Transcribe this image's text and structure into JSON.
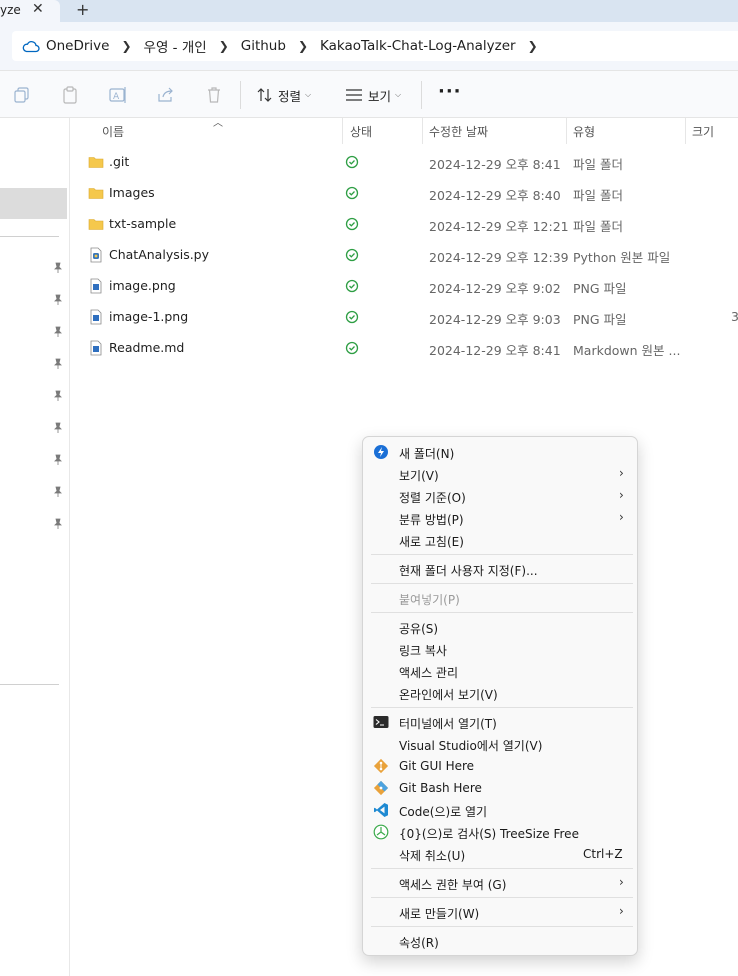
{
  "tab": {
    "title": "yze",
    "close": "✕",
    "new": "+"
  },
  "breadcrumb": [
    "OneDrive",
    "우영 - 개인",
    "Github",
    "KakaoTalk-Chat-Log-Analyzer"
  ],
  "toolbar": {
    "sort_label": "정렬",
    "view_label": "보기",
    "more": "···"
  },
  "columns": {
    "name": "이름",
    "status": "상태",
    "modified": "수정한 날짜",
    "type": "유형",
    "size": "크기"
  },
  "files": [
    {
      "name": ".git",
      "icon": "folder-icon",
      "date": "2024-12-29 오후 8:41",
      "type": "파일 폴더",
      "size": ""
    },
    {
      "name": "Images",
      "icon": "folder-icon",
      "date": "2024-12-29 오후 8:40",
      "type": "파일 폴더",
      "size": ""
    },
    {
      "name": "txt-sample",
      "icon": "folder-icon",
      "date": "2024-12-29 오후 12:21",
      "type": "파일 폴더",
      "size": ""
    },
    {
      "name": "ChatAnalysis.py",
      "icon": "python-file-icon",
      "date": "2024-12-29 오후 12:39",
      "type": "Python 원본 파일",
      "size": ""
    },
    {
      "name": "image.png",
      "icon": "image-file-icon",
      "date": "2024-12-29 오후 9:02",
      "type": "PNG 파일",
      "size": ""
    },
    {
      "name": "image-1.png",
      "icon": "image-file-icon",
      "date": "2024-12-29 오후 9:03",
      "type": "PNG 파일",
      "size": "3"
    },
    {
      "name": "Readme.md",
      "icon": "markdown-file-icon",
      "date": "2024-12-29 오후 8:41",
      "type": "Markdown 원본 ...",
      "size": ""
    }
  ],
  "menu": {
    "new_folder": "새 폴더(N)",
    "view": "보기(V)",
    "sort_by": "정렬 기준(O)",
    "group_by": "분류 방법(P)",
    "refresh": "새로 고침(E)",
    "customize": "현재 폴더 사용자 지정(F)...",
    "paste": "붙여넣기(P)",
    "share": "공유(S)",
    "copy_link": "링크 복사",
    "manage_access": "액세스 관리",
    "view_online": "온라인에서 보기(V)",
    "open_terminal": "터미널에서 열기(T)",
    "open_vs": "Visual Studio에서 열기(V)",
    "git_gui": "Git GUI Here",
    "git_bash": "Git Bash Here",
    "open_code": "Code(으)로 열기",
    "treesize": "{0}(으)로 검사(S) TreeSize Free",
    "undo_delete": "삭제 취소(U)",
    "undo_shortcut": "Ctrl+Z",
    "give_access": "액세스 권한 부여 (G)",
    "new": "새로 만들기(W)",
    "properties": "속성(R)"
  },
  "colors": {
    "accent": "#0067c0",
    "folder": "#f5c84c",
    "status_green": "#2e9e44"
  }
}
